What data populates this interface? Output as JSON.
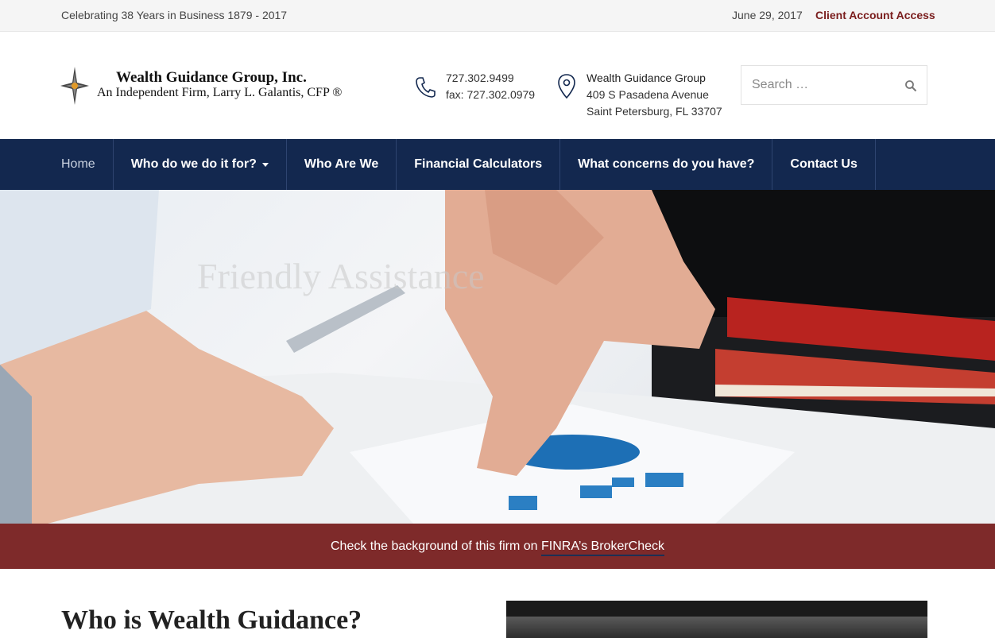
{
  "topbar": {
    "tagline": "Celebrating 38 Years in Business 1879 - 2017",
    "date": "June 29, 2017",
    "client_access": "Client Account Access"
  },
  "header": {
    "logo_name": "Wealth Guidance Group, Inc.",
    "logo_tagline": "An Independent Firm, Larry L. Galantis, CFP ®",
    "phone": "727.302.9499",
    "fax": "fax: 727.302.0979",
    "address_name": "Wealth Guidance Group",
    "address_street": "409 S Pasadena Avenue",
    "address_city": "Saint Petersburg, FL 33707",
    "search_placeholder": "Search …"
  },
  "nav": {
    "items": [
      {
        "label": "Home"
      },
      {
        "label": "Who do we do it for?"
      },
      {
        "label": "Who Are We"
      },
      {
        "label": "Financial Calculators"
      },
      {
        "label": "What concerns do you have?"
      },
      {
        "label": "Contact Us"
      }
    ]
  },
  "hero": {
    "overlay_text": "Friendly Assistance"
  },
  "banner": {
    "text": "Check the background of this firm on ",
    "link": "FINRA’s BrokerCheck"
  },
  "content": {
    "title": "Who is Wealth Guidance?"
  },
  "colors": {
    "nav_bg": "#13284f",
    "banner_bg": "#7e2a2a",
    "accent": "#7a1d1d"
  }
}
